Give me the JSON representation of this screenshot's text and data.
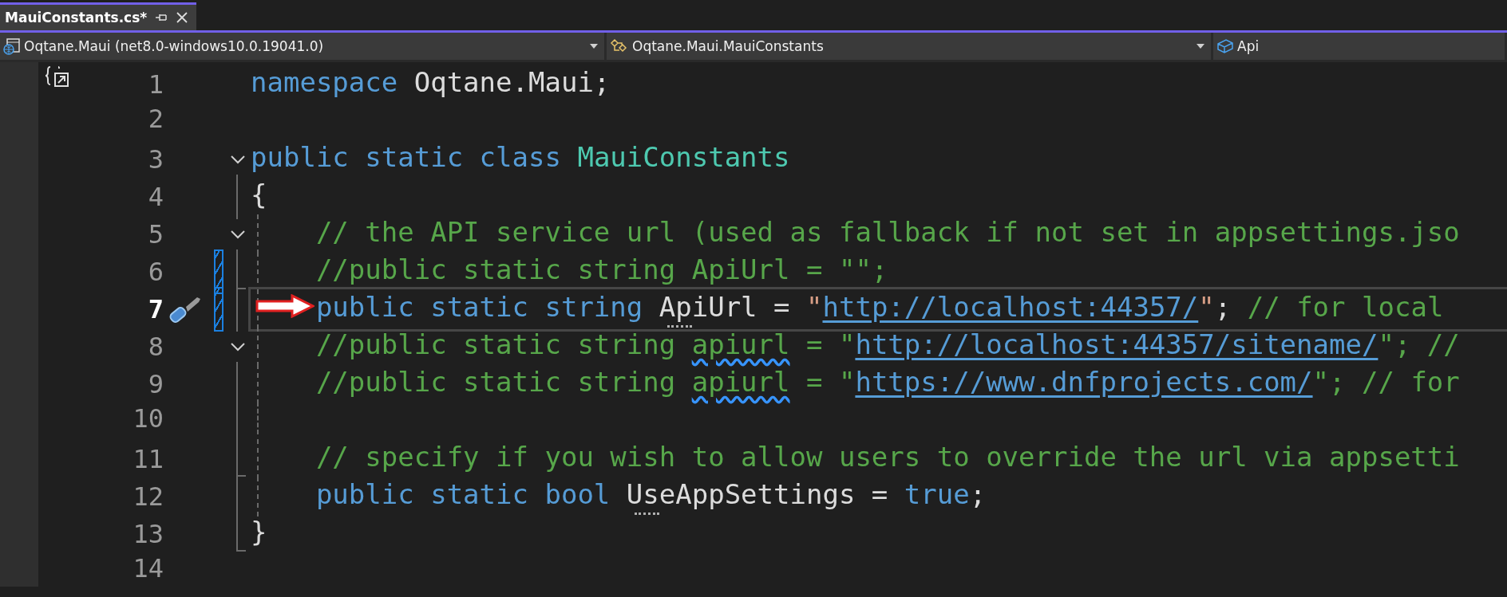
{
  "tab": {
    "title": "MauiConstants.cs*",
    "selected": true
  },
  "navigation": [
    {
      "kind": "project",
      "label": "Oqtane.Maui (net8.0-windows10.0.19041.0)"
    },
    {
      "kind": "class",
      "label": "Oqtane.Maui.MauiConstants"
    },
    {
      "kind": "member",
      "label": "Api"
    }
  ],
  "lines": [
    {
      "number": "1",
      "current": false,
      "code_lens": true,
      "tokens": [
        {
          "kind": "keyword",
          "text": "namespace"
        },
        {
          "kind": "plain",
          "text": " Oqtane.Maui;"
        }
      ]
    },
    {
      "number": "2",
      "current": false
    },
    {
      "number": "3",
      "current": false,
      "collapsible": true,
      "tokens": [
        {
          "kind": "keyword",
          "text": "public static class "
        },
        {
          "kind": "type",
          "text": "MauiConstants"
        }
      ]
    },
    {
      "number": "4",
      "current": false,
      "in_block": true,
      "tokens": [
        {
          "kind": "plain",
          "text": "{"
        }
      ]
    },
    {
      "number": "5",
      "current": false,
      "collapsible": true,
      "indent": true,
      "tokens": [
        {
          "kind": "comment",
          "text": "// the API service url (used as fallback if not set in appsettings.jso"
        }
      ]
    },
    {
      "number": "6",
      "current": false,
      "changed": true,
      "in_block": true,
      "block_end": true,
      "indent": true,
      "tokens": [
        {
          "kind": "comment",
          "text": "//public static string ApiUrl = \"\";"
        }
      ]
    },
    {
      "number": "7",
      "current": true,
      "changed": true,
      "in_block": true,
      "indent": true,
      "pointer": true,
      "quick_action": true,
      "tokens": [
        {
          "kind": "keyword",
          "text": "public static string "
        },
        {
          "kind": "plain",
          "text": "ApiUrl",
          "suggestion": true
        },
        {
          "kind": "plain",
          "text": " = "
        },
        {
          "kind": "string",
          "text": "\""
        },
        {
          "kind": "link",
          "text": "http://localhost:44357/"
        },
        {
          "kind": "string",
          "text": "\""
        },
        {
          "kind": "plain",
          "text": ";"
        },
        {
          "kind": "comment",
          "text": " // for local"
        }
      ]
    },
    {
      "number": "8",
      "current": false,
      "collapsible": true,
      "indent": true,
      "tokens": [
        {
          "kind": "comment",
          "text": "//public static string "
        },
        {
          "kind": "comment",
          "text": "apiurl",
          "warning": true
        },
        {
          "kind": "comment",
          "text": " = \""
        },
        {
          "kind": "link",
          "text": "http://localhost:44357/sitename/"
        },
        {
          "kind": "comment",
          "text": "\"; //"
        }
      ]
    },
    {
      "number": "9",
      "current": false,
      "in_block": true,
      "indent": true,
      "tokens": [
        {
          "kind": "comment",
          "text": "//public static string "
        },
        {
          "kind": "comment",
          "text": "apiurl",
          "warning": true
        },
        {
          "kind": "comment",
          "text": " = \""
        },
        {
          "kind": "link",
          "text": "https://www.dnfprojects.com/"
        },
        {
          "kind": "comment",
          "text": "\"; // for"
        }
      ]
    },
    {
      "number": "10",
      "current": false,
      "in_block": true,
      "indent": true
    },
    {
      "number": "11",
      "current": false,
      "in_block": true,
      "block_end": true,
      "indent": true,
      "tokens": [
        {
          "kind": "comment",
          "text": "// specify if you wish to allow users to override the url via appsetti"
        }
      ]
    },
    {
      "number": "12",
      "current": false,
      "in_block": true,
      "indent": true,
      "tokens": [
        {
          "kind": "keyword",
          "text": "public static bool "
        },
        {
          "kind": "plain",
          "text": "UseAppSettings",
          "suggestion": true
        },
        {
          "kind": "plain",
          "text": " = "
        },
        {
          "kind": "keyword",
          "text": "true"
        },
        {
          "kind": "plain",
          "text": ";"
        }
      ]
    },
    {
      "number": "13",
      "current": false,
      "in_block": true,
      "block_end": true,
      "tokens": [
        {
          "kind": "plain",
          "text": "}"
        }
      ]
    },
    {
      "number": "14",
      "current": false
    }
  ]
}
